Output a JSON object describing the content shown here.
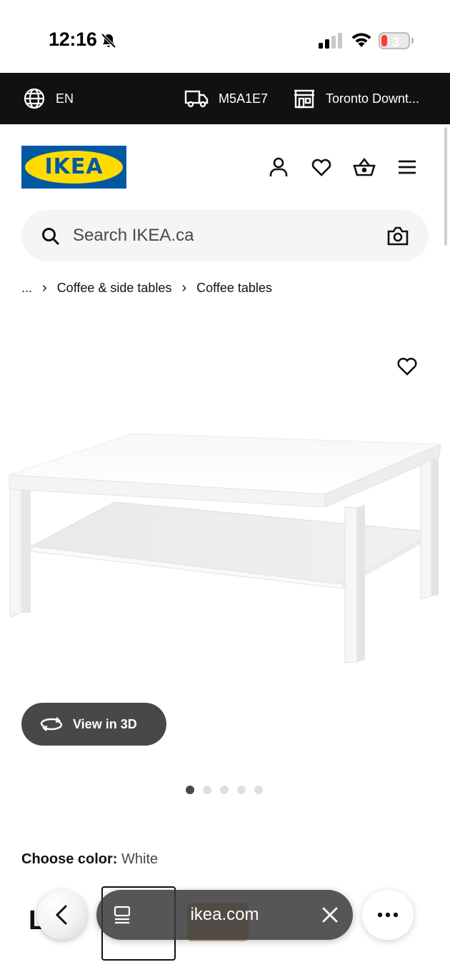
{
  "status_bar": {
    "time": "12:16",
    "battery_level": "3",
    "icons": [
      "bell-slash-icon",
      "cellular-signal-icon",
      "wifi-icon",
      "battery-icon"
    ]
  },
  "top_strip": {
    "language": "EN",
    "postal_code": "M5A1E7",
    "store": "Toronto Downt..."
  },
  "header": {
    "logo_text": "IKEA",
    "icons": [
      "account-icon",
      "favourites-icon",
      "cart-icon",
      "menu-icon"
    ]
  },
  "search": {
    "placeholder": "Search IKEA.ca"
  },
  "breadcrumb": {
    "items": [
      "...",
      "Coffee & side tables",
      "Coffee tables"
    ]
  },
  "product": {
    "view_3d_label": "View in 3D",
    "image_count": 5,
    "active_image_index": 0,
    "choose_color_label": "Choose color:",
    "choose_color_value": "White",
    "title_partial": "L"
  },
  "browser": {
    "url": "ikea.com"
  },
  "colors": {
    "ikea_blue": "#0058a3",
    "ikea_yellow": "#ffdb00",
    "strip_bg": "#111111",
    "view3d_bg": "#484848"
  }
}
